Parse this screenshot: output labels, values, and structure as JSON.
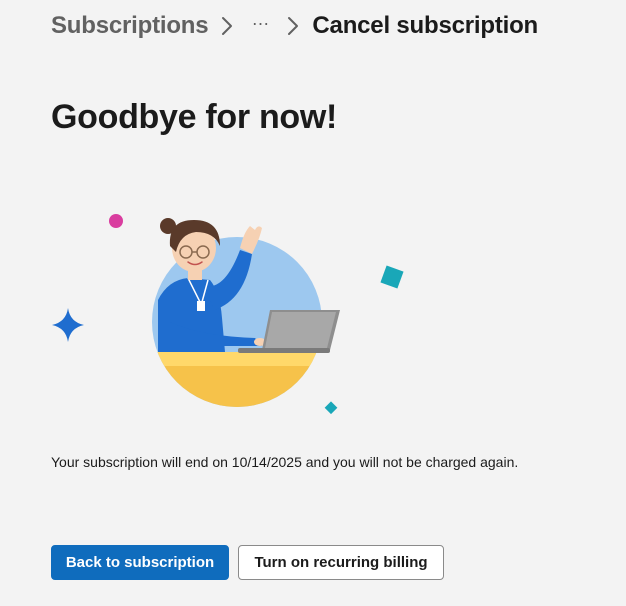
{
  "breadcrumb": {
    "root": "Subscriptions",
    "ellipsis": "···",
    "current": "Cancel subscription"
  },
  "heading": "Goodbye for now!",
  "message": "Your subscription will end on 10/14/2025 and you will not be charged again.",
  "buttons": {
    "primary": "Back to subscription",
    "secondary": "Turn on recurring billing"
  },
  "icons": {
    "separator": "chevron-right-icon",
    "sparkle": "sparkle-icon"
  },
  "colors": {
    "accent": "#0f6cbd",
    "background": "#f3f3f3",
    "circle": "#9dc8ef",
    "desk": "#f6c24a",
    "shirt": "#1f6dcf",
    "teal": "#19a7b8",
    "magenta": "#d93d9f"
  }
}
